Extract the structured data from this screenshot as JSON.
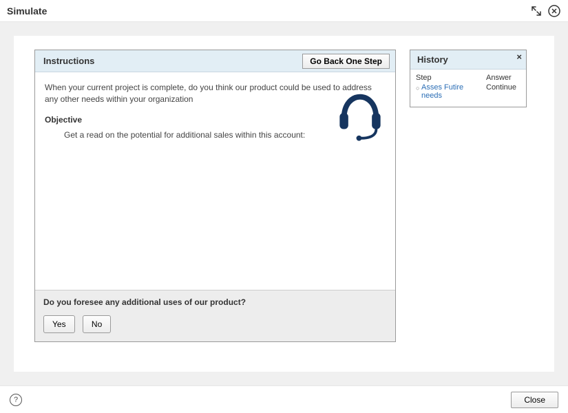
{
  "window": {
    "title": "Simulate"
  },
  "instructions": {
    "panel_title": "Instructions",
    "go_back_label": "Go Back One Step",
    "body_text": "When your current project is complete, do you think our product could be used to address any other needs within your organization",
    "objective_label": "Objective",
    "objective_text": "Get a read on the potential for additional sales within this account:"
  },
  "question": {
    "text": "Do you foresee any additional uses of our product?",
    "yes_label": "Yes",
    "no_label": "No"
  },
  "history": {
    "panel_title": "History",
    "col_step": "Step",
    "col_answer": "Answer",
    "rows": [
      {
        "step": "Asses Futire needs",
        "answer": "Continue"
      }
    ]
  },
  "footer": {
    "close_label": "Close"
  }
}
